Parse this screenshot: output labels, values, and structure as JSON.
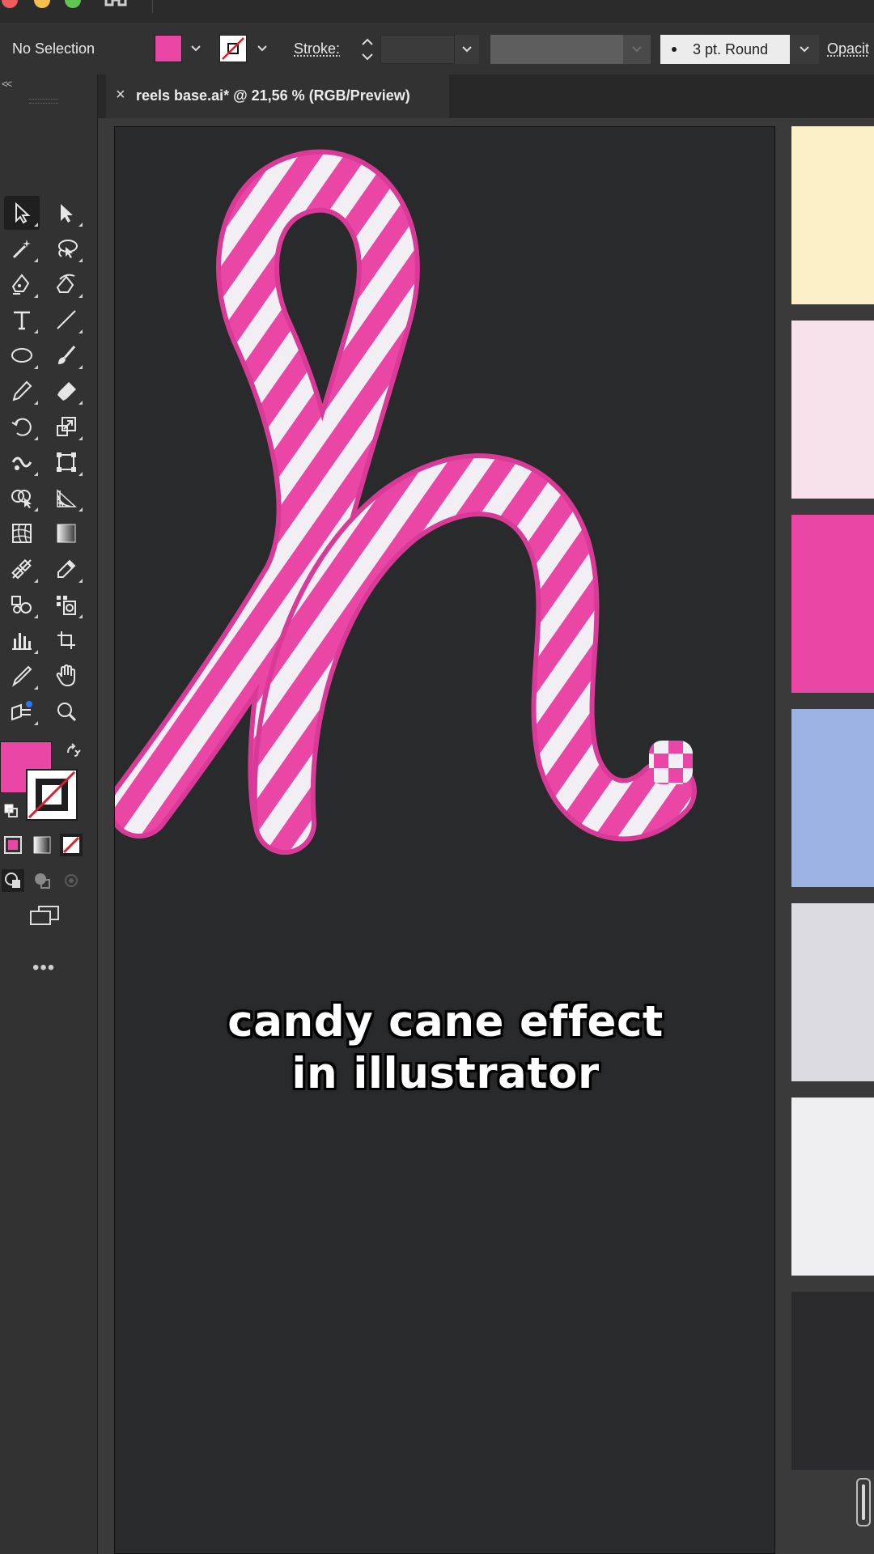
{
  "window": {
    "traffic_lights": [
      "#ed5e5a",
      "#f4bf4f",
      "#61c554"
    ]
  },
  "control_bar": {
    "selection_status": "No Selection",
    "fill_color": "#ea46a6",
    "stroke_label": "Stroke:",
    "stroke_weight": "",
    "brush_definition": "3 pt. Round",
    "opacity_label": "Opacit"
  },
  "document_tab": {
    "close_glyph": "×",
    "title": "reels base.ai* @ 21,56 % (RGB/Preview)"
  },
  "toolbar": {
    "collapse_glyph": "<<",
    "more_glyph": "•••",
    "active_tool": "selection-tool",
    "tools": [
      [
        "selection-tool",
        "direct-selection-tool"
      ],
      [
        "magic-wand-tool",
        "lasso-tool"
      ],
      [
        "pen-tool",
        "curvature-tool"
      ],
      [
        "type-tool",
        "line-segment-tool"
      ],
      [
        "ellipse-tool",
        "paintbrush-tool"
      ],
      [
        "pencil-tool",
        "eraser-tool"
      ],
      [
        "rotate-tool",
        "scale-tool"
      ],
      [
        "warp-tool",
        "free-transform-tool"
      ],
      [
        "shape-builder-tool",
        "perspective-grid-tool"
      ],
      [
        "mesh-tool",
        "gradient-tool"
      ],
      [
        "blend-tool",
        "eyedropper-tool"
      ],
      [
        "symbol-sprayer-tool",
        "symbol-tool"
      ],
      [
        "graph-tool",
        "artboard-tool"
      ],
      [
        "slice-tool",
        "hand-tool"
      ],
      [
        "puppet-warp-tool",
        "zoom-tool"
      ]
    ],
    "fill_swatch": "#ea46a6",
    "stroke_swatch": "none"
  },
  "artboard": {
    "background": "#292a2c",
    "artwork": "candy-cane-letter-h",
    "stripe_colors": [
      "#ea46a6",
      "#f1eff4"
    ],
    "caption_line1": "candy cane effect",
    "caption_line2": "in illustrator"
  },
  "swatch_panel": {
    "colors": [
      "#fcf0c8",
      "#f7e2ec",
      "#ea46a6",
      "#9cb2e2",
      "#dcdbe0",
      "#efeff1",
      "#2a2a2c"
    ]
  }
}
